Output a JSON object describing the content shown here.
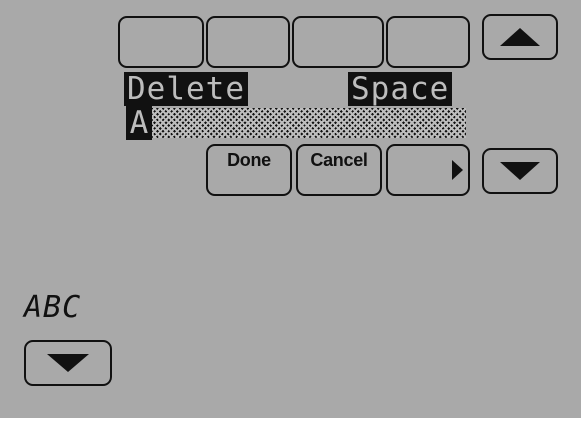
{
  "keyboard_row": {
    "keys": [
      "",
      "",
      "",
      ""
    ],
    "scroll_up_icon": "triangle-up-icon"
  },
  "controls": {
    "delete_label": "Delete",
    "space_label": "Space"
  },
  "entry": {
    "value": "A"
  },
  "actions": {
    "done_label": "Done",
    "cancel_label": "Cancel",
    "next_icon": "triangle-right-icon",
    "scroll_down_icon": "triangle-down-icon"
  },
  "mode": {
    "label": "ABC",
    "toggle_icon": "triangle-down-icon"
  },
  "colors": {
    "background": "#a9a9a9",
    "foreground": "#111111",
    "lcd_text": "#bdbdbd"
  }
}
